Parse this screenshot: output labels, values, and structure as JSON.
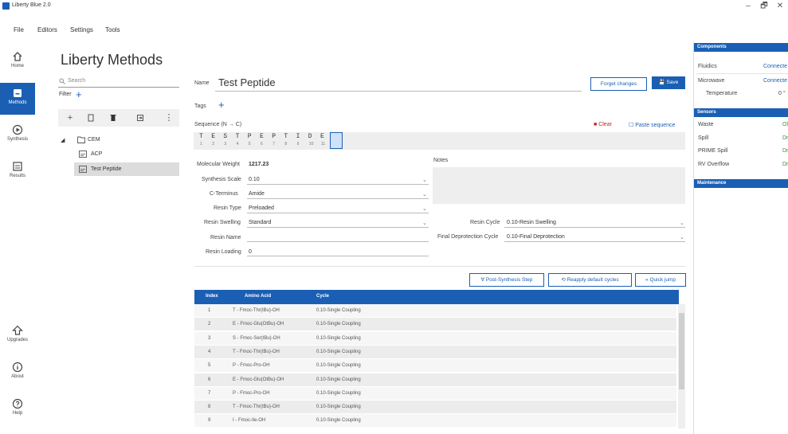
{
  "window": {
    "title": "Liberty Blue 2.0",
    "min": "–",
    "restore": "🗗",
    "close": "✕"
  },
  "menu": [
    "File",
    "Editors",
    "Settings",
    "Tools"
  ],
  "nav": {
    "home": "Home",
    "methods": "Methods",
    "synthesis": "Synthesis",
    "results": "Results",
    "upgrades": "Upgrades",
    "about": "About",
    "help": "Help"
  },
  "methods": {
    "title": "Liberty Methods",
    "search_placeholder": "Search",
    "filter_label": "Filter",
    "tree": {
      "root": "CEM",
      "child1": "ACP",
      "child2": "Test Peptide"
    }
  },
  "form": {
    "name_label": "Name",
    "name_value": "Test Peptide",
    "forget_button": "Forget changes",
    "save_button": "Save",
    "tags_label": "Tags",
    "sequence_label": "Sequence (N → C)",
    "clear_button": "Clear",
    "paste_button": "Paste sequence",
    "sequence": [
      {
        "aa": "T",
        "idx": "1"
      },
      {
        "aa": "E",
        "idx": "2"
      },
      {
        "aa": "S",
        "idx": "3"
      },
      {
        "aa": "T",
        "idx": "4"
      },
      {
        "aa": "P",
        "idx": "5"
      },
      {
        "aa": "E",
        "idx": "6"
      },
      {
        "aa": "P",
        "idx": "7"
      },
      {
        "aa": "T",
        "idx": "8"
      },
      {
        "aa": "I",
        "idx": "9"
      },
      {
        "aa": "D",
        "idx": "10"
      },
      {
        "aa": "E",
        "idx": "11"
      }
    ],
    "mw_label": "Molecular Weight",
    "mw_value": "1217.23",
    "notes_label": "Notes",
    "synthesis_scale_label": "Synthesis Scale",
    "synthesis_scale_value": "0.10",
    "c_terminus_label": "C-Terminus",
    "c_terminus_value": "Amide",
    "resin_type_label": "Resin Type",
    "resin_type_value": "Preloaded",
    "resin_swelling_label": "Resin Swelling",
    "resin_swelling_value": "Standard",
    "resin_name_label": "Resin Name",
    "resin_name_value": "",
    "resin_loading_label": "Resin Loading",
    "resin_loading_value": "0",
    "resin_cycle_label": "Resin Cycle",
    "resin_cycle_value": "0.10-Resin Swelling",
    "final_deprot_label": "Final Deprotection Cycle",
    "final_deprot_value": "0.10-Final Deprotection",
    "post_synthesis_button": "Post-Synthesis Step",
    "reapply_button": "Reapply default cycles",
    "quick_jump_button": "Quick jump"
  },
  "table": {
    "headers": [
      "Index",
      "Amino Acid",
      "Cycle"
    ],
    "rows": [
      [
        "1",
        "T - Fmoc-Thr(tBu)-OH",
        "0.10-Single Coupling"
      ],
      [
        "2",
        "E - Fmoc-Glu(OtBu)-OH",
        "0.10-Single Coupling"
      ],
      [
        "3",
        "S - Fmoc-Ser(tBu)-OH",
        "0.10-Single Coupling"
      ],
      [
        "4",
        "T - Fmoc-Thr(tBu)-OH",
        "0.10-Single Coupling"
      ],
      [
        "5",
        "P - Fmoc-Pro-OH",
        "0.10-Single Coupling"
      ],
      [
        "6",
        "E - Fmoc-Glu(OtBu)-OH",
        "0.10-Single Coupling"
      ],
      [
        "7",
        "P - Fmoc-Pro-OH",
        "0.10-Single Coupling"
      ],
      [
        "8",
        "T - Fmoc-Thr(tBu)-OH",
        "0.10-Single Coupling"
      ],
      [
        "9",
        "I - Fmoc-Ile-OH",
        "0.10-Single Coupling"
      ]
    ]
  },
  "right_panel": {
    "components_header": "Components",
    "fluidics_label": "Fluidics",
    "fluidics_value": "Connecte",
    "microwave_label": "Microwave",
    "microwave_value": "Connecte",
    "temperature_label": "Temperature",
    "temperature_value": "0 °",
    "sensors_header": "Sensors",
    "waste_label": "Waste",
    "waste_value": "Ol",
    "spill_label": "Spill",
    "spill_value": "Dr",
    "prime_spill_label": "PRIME Spill",
    "prime_spill_value": "Dr",
    "rv_overflow_label": "RV Overflow",
    "rv_overflow_value": "Dr",
    "maintenance_header": "Maintenance"
  },
  "colors": {
    "accent": "#1a5fb4",
    "ok": "#2e9a35",
    "clear": "#c0262c"
  }
}
